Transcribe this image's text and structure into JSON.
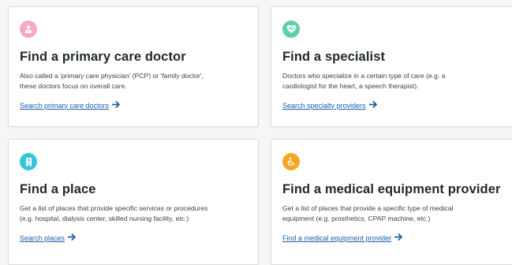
{
  "cards": [
    {
      "icon": "doctor-icon",
      "icon_color": "#f7a8c4",
      "title": "Find a primary care doctor",
      "desc_lines": [
        "Also called a 'primary care physician' (PCP) or 'family doctor',",
        "these doctors focus on overall care."
      ],
      "link": "Search primary care doctors"
    },
    {
      "icon": "heart-pulse-icon",
      "icon_color": "#5fd0a6",
      "title": "Find a specialist",
      "desc_lines": [
        "Doctors who specialize in a certain type of care (e.g. a",
        "cardiologist for the heart, a speech therapist)."
      ],
      "link": "Search specialty providers"
    },
    {
      "icon": "building-icon",
      "icon_color": "#34c4dc",
      "title": "Find a place",
      "desc_lines": [
        "Get a list of places that provide specific services or procedures",
        "(e.g. hospital, dialysis center, skilled nursing facility, etc.)"
      ],
      "link": "Search places"
    },
    {
      "icon": "wheelchair-icon",
      "icon_color": "#f5a623",
      "title": "Find a medical equipment provider",
      "desc_lines": [
        "Get a list of places that provide a specific type of medical",
        "equipment (e.g. prosthetics, CPAP machine, etc.)"
      ],
      "link": "Find a medical equipment provider"
    }
  ],
  "colors": {
    "link": "#1a5ea8",
    "title": "#22292f",
    "border": "#d8dcdf"
  }
}
